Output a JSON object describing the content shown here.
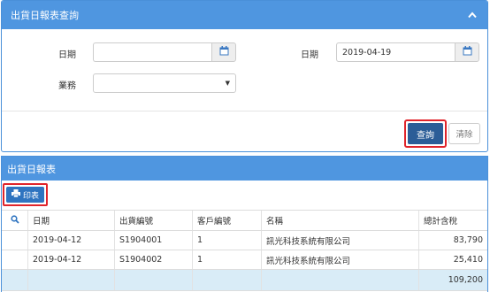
{
  "query_panel": {
    "title": "出貨日報表查詢",
    "fields": {
      "date_from_label": "日期",
      "date_from_value": "",
      "date_to_label": "日期",
      "date_to_value": "2019-04-19",
      "business_label": "業務",
      "business_value": ""
    },
    "query_button": "查詢",
    "clear_button": "清除"
  },
  "report_panel": {
    "title": "出貨日報表",
    "print_button": "印表",
    "columns": [
      "日期",
      "出貨編號",
      "客戶編號",
      "名稱",
      "總計含稅"
    ],
    "rows": [
      {
        "date": "2019-04-12",
        "ship_no": "S1904001",
        "cust_no": "1",
        "name": "訊光科技系統有限公司",
        "total": "83,790"
      },
      {
        "date": "2019-04-12",
        "ship_no": "S1904002",
        "cust_no": "1",
        "name": "訊光科技系統有限公司",
        "total": "25,410"
      }
    ],
    "grand_total": "109,200"
  },
  "colors": {
    "header_blue": "#4f96e0",
    "query_button": "#2b5d97",
    "highlight_red": "#e0242b",
    "total_row": "#d9ecf7"
  }
}
